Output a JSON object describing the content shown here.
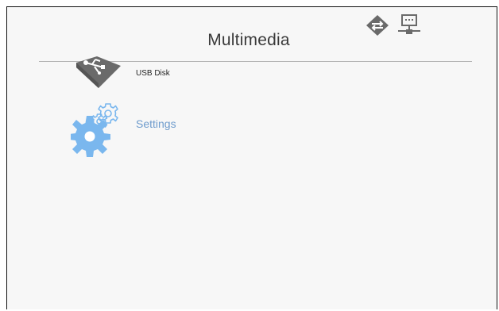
{
  "header": {
    "title": "Multimedia"
  },
  "status_bar": {
    "icons": [
      "wifi-direct-icon",
      "network-lan-icon"
    ]
  },
  "menu": {
    "items": [
      {
        "label": "USB Disk",
        "icon": "usb-disk-icon",
        "selected": false
      },
      {
        "label": "Settings",
        "icon": "settings-gears-icon",
        "selected": true
      }
    ]
  },
  "colors": {
    "background": "#f7f7f7",
    "title_text": "#3a3a3a",
    "selected_text": "#6f9ccd",
    "selected_icon": "#7ab7ee",
    "icon_gray": "#6a6a6a"
  }
}
